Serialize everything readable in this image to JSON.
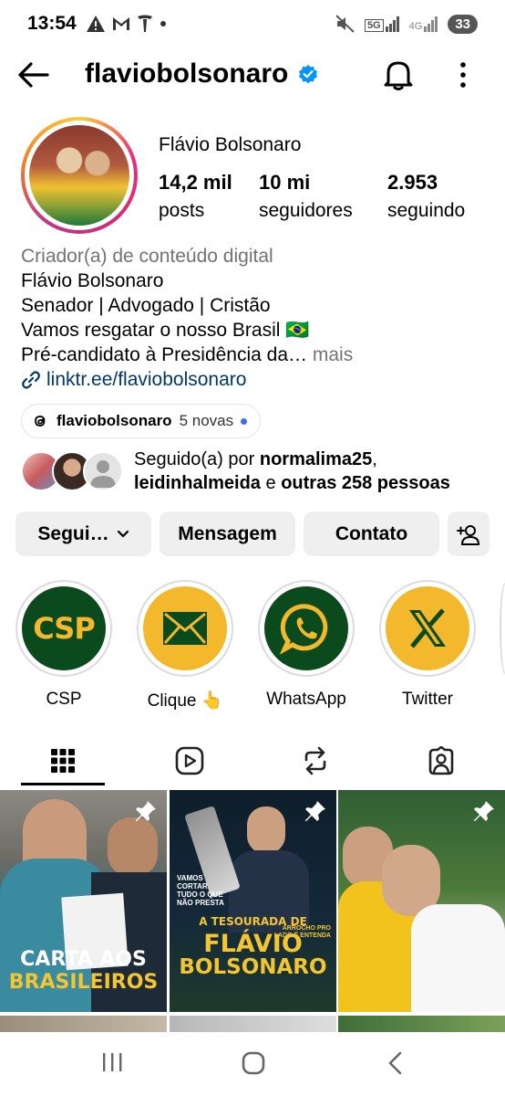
{
  "status_bar": {
    "time": "13:54",
    "left_icons": [
      "warning-icon",
      "gmail-icon",
      "tesla-icon",
      "dot-icon"
    ],
    "right_icons": [
      "mute-icon",
      "5g-signal-icon",
      "4g-signal-icon"
    ],
    "network_5g": "5G",
    "network_4g": "4G",
    "battery": "33"
  },
  "header": {
    "username": "flaviobolsonaro",
    "verified": true
  },
  "profile": {
    "full_name": "Flávio Bolsonaro",
    "stats": [
      {
        "value": "14,2 mil",
        "label": "posts"
      },
      {
        "value": "10 mi",
        "label": "seguidores"
      },
      {
        "value": "2.953",
        "label": "seguindo"
      }
    ],
    "category": "Criador(a) de conteúdo digital",
    "bio_lines": [
      "Flávio Bolsonaro",
      "Senador | Advogado | Cristão",
      "Vamos resgatar o nosso Brasil 🇧🇷",
      "Pré-candidato à Presidência da…"
    ],
    "more": "mais",
    "link": "linktr.ee/flaviobolsonaro",
    "threads": {
      "name": "flaviobolsonaro",
      "badge": "5 novas"
    },
    "followed_by": {
      "prefix": "Seguido(a) por ",
      "user1": "normalima25",
      "sep": ",",
      "user2": "leidinhalmeida",
      "middle": " e ",
      "others": "outras 258 pessoas"
    }
  },
  "actions": {
    "following": "Segui…",
    "message": "Mensagem",
    "contact": "Contato"
  },
  "highlights": [
    {
      "label": "CSP",
      "inner": "CSP"
    },
    {
      "label": "Clique 👆",
      "icon": "envelope-icon"
    },
    {
      "label": "WhatsApp",
      "icon": "whatsapp-icon"
    },
    {
      "label": "Twitter",
      "icon": "x-logo-icon"
    }
  ],
  "tabs": [
    "grid-icon",
    "reels-icon",
    "reposts-icon",
    "tagged-icon"
  ],
  "posts": [
    {
      "overlay": [
        "CARTA AOS",
        "BRASILEIROS"
      ],
      "pinned": true
    },
    {
      "overlay": [
        "A TESOURADA DE",
        "FLÁVIO",
        "BOLSONARO"
      ],
      "small_left": [
        "VAMOS",
        "CORTAR",
        "TUDO O QUE",
        "NÃO PRESTA"
      ],
      "small_right": [
        "ARROCHO PRO",
        "LADO É ENTENDA"
      ],
      "pinned": true
    },
    {
      "overlay": [],
      "pinned": true
    }
  ],
  "colors": {
    "link": "#00376b",
    "secondary": "#737373",
    "verified": "#0095f6",
    "button_bg": "#efefef",
    "highlight_green": "#0b4a1c",
    "highlight_yellow": "#f3b82c"
  }
}
